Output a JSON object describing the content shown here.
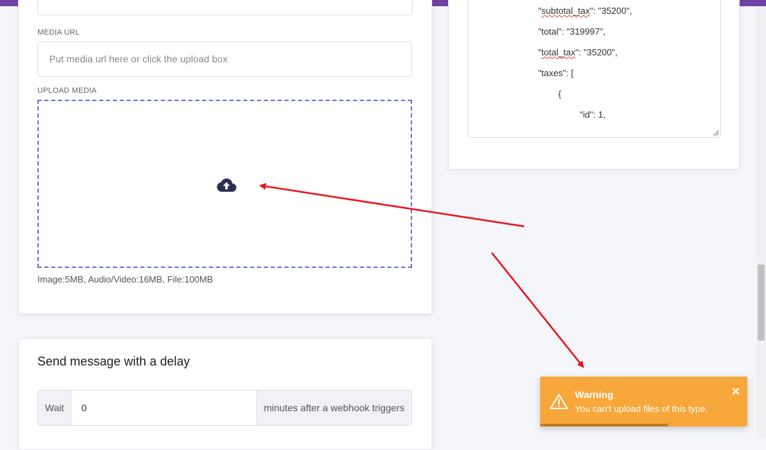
{
  "media_form": {
    "media_url_label": "MEDIA URL",
    "media_url_placeholder": "Put media url here or click the upload box",
    "upload_label": "UPLOAD MEDIA",
    "upload_icon": "cloud-upload-icon",
    "size_hint": "Image:5MB, Audio/Video:16MB, File:100MB"
  },
  "json_preview": {
    "lines": [
      "\"subtotal_tax\": \"35200\",",
      "\"total\": \"319997\",",
      "\"total_tax\": \"35200\",",
      "\"taxes\": [",
      "{",
      "\"id\": 1,"
    ]
  },
  "delay": {
    "title": "Send message with a delay",
    "prefix": "Wait",
    "value": "0",
    "suffix": "minutes after a webhook triggers"
  },
  "toast": {
    "title": "Warning",
    "message": "You can't upload files of this type.",
    "icon": "warning-triangle-icon",
    "close_icon": "close-icon",
    "progress": 0.62,
    "color": "#f8a73a"
  },
  "colors": {
    "header": "#6f42a5",
    "upload_border": "#6674de",
    "annotation_arrow": "#e8141b"
  }
}
